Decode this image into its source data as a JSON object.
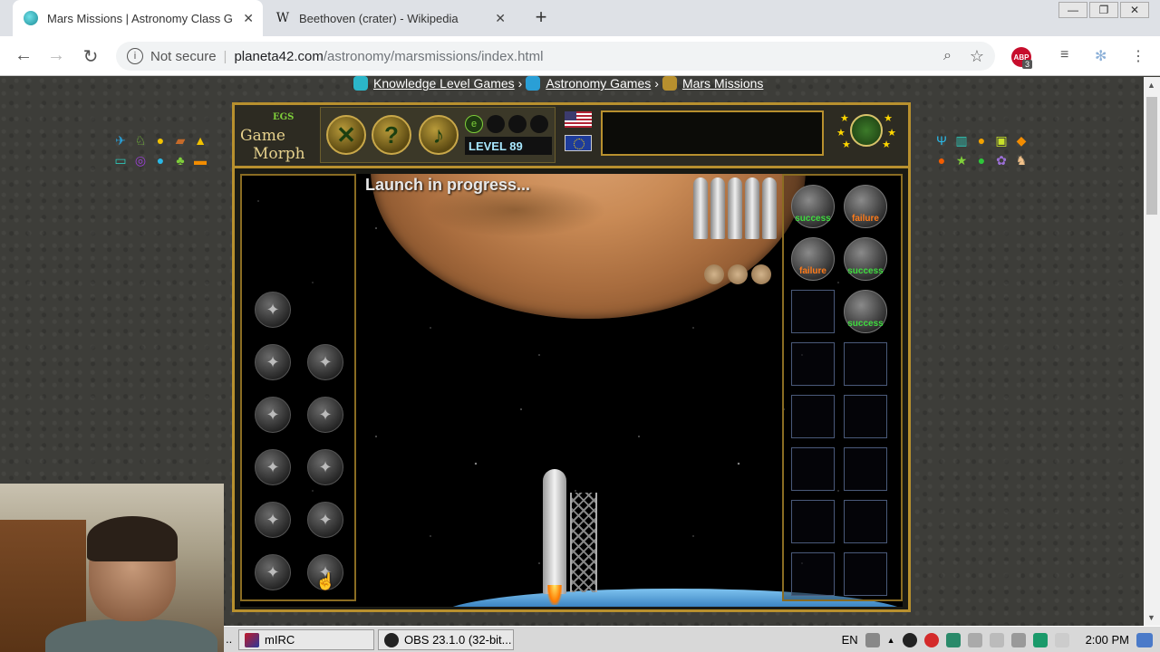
{
  "browser": {
    "tabs": [
      {
        "title": "Mars Missions | Astronomy Class Ga",
        "active": true,
        "favicon": "globe-icon"
      },
      {
        "title": "Beethoven (crater) - Wikipedia",
        "active": false,
        "favicon": "wikipedia-icon"
      }
    ],
    "omnibox": {
      "security": "Not secure",
      "domain": "planeta42.com",
      "path": "/astronomy/marsmissions/index.html"
    },
    "extension_badge": "3",
    "extension_label": "ABP"
  },
  "breadcrumbs": [
    {
      "label": "Knowledge Level Games",
      "color": "#2bb6c9"
    },
    {
      "label": "Astronomy Games",
      "color": "#2a9fd6"
    },
    {
      "label": "Mars Missions",
      "color": "#b8902e"
    }
  ],
  "breadcrumb_sep": "›",
  "game": {
    "logo_top": "EGS",
    "logo_line1": "Game",
    "logo_line2": "Morph",
    "level": "LEVEL 89",
    "status": "Launch in progress...",
    "missions": [
      {
        "result": "success"
      },
      {
        "result": "failure"
      },
      {
        "result": "failure"
      },
      {
        "result": "success"
      },
      {
        "result": ""
      },
      {
        "result": "success"
      }
    ]
  },
  "taskbar": {
    "more": "..",
    "items": [
      {
        "label": "mIRC"
      },
      {
        "label": "OBS 23.1.0 (32-bit..."
      }
    ],
    "lang": "EN",
    "clock": "2:00 PM"
  }
}
